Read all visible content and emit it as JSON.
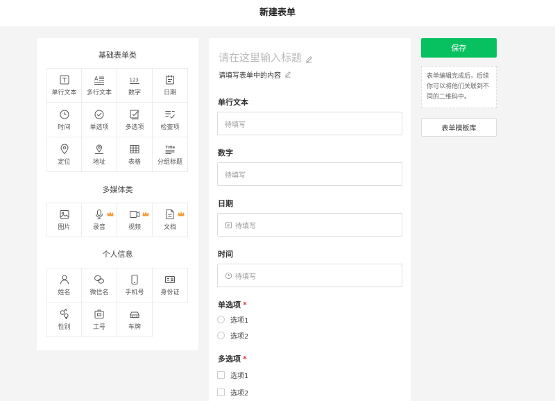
{
  "header": {
    "title": "新建表单"
  },
  "palette": {
    "basic_title": "基础表单类",
    "basic_items": [
      {
        "label": "单行文本",
        "icon": "single-line-text-icon"
      },
      {
        "label": "多行文本",
        "icon": "multi-line-text-icon"
      },
      {
        "label": "数字",
        "icon": "number-icon"
      },
      {
        "label": "日期",
        "icon": "calendar-icon"
      },
      {
        "label": "时间",
        "icon": "clock-icon"
      },
      {
        "label": "单选项",
        "icon": "radio-check-icon"
      },
      {
        "label": "多选项",
        "icon": "checkbox-icon"
      },
      {
        "label": "检查项",
        "icon": "checklist-icon"
      },
      {
        "label": "定位",
        "icon": "location-pin-icon"
      },
      {
        "label": "地址",
        "icon": "address-pin-icon"
      },
      {
        "label": "表格",
        "icon": "table-icon"
      },
      {
        "label": "分组标题",
        "icon": "group-title-icon"
      }
    ],
    "media_title": "多媒体类",
    "media_items": [
      {
        "label": "图片",
        "icon": "image-icon",
        "premium": false
      },
      {
        "label": "录音",
        "icon": "microphone-icon",
        "premium": true
      },
      {
        "label": "视频",
        "icon": "video-icon",
        "premium": true
      },
      {
        "label": "文档",
        "icon": "document-icon",
        "premium": true
      }
    ],
    "personal_title": "个人信息",
    "personal_items": [
      {
        "label": "姓名",
        "icon": "person-icon"
      },
      {
        "label": "微信名",
        "icon": "wechat-icon"
      },
      {
        "label": "手机号",
        "icon": "phone-icon"
      },
      {
        "label": "身份证",
        "icon": "id-card-icon"
      },
      {
        "label": "性别",
        "icon": "gender-icon"
      },
      {
        "label": "工号",
        "icon": "badge-icon"
      },
      {
        "label": "车牌",
        "icon": "car-icon"
      }
    ],
    "premium_color": "#f39c38"
  },
  "form": {
    "title_placeholder": "请在这里输入标题",
    "desc_placeholder": "请填写表单中的内容",
    "fields": {
      "single_text": {
        "label": "单行文本",
        "placeholder": "待填写"
      },
      "number": {
        "label": "数字",
        "placeholder": "待填写"
      },
      "date": {
        "label": "日期",
        "placeholder": "待填写"
      },
      "time": {
        "label": "时间",
        "placeholder": "待填写"
      },
      "single_choice": {
        "label": "单选项",
        "required_mark": "*",
        "options": [
          "选项1",
          "选项2"
        ]
      },
      "multi_choice": {
        "label": "多选项",
        "required_mark": "*",
        "options": [
          "选项1",
          "选项2"
        ]
      }
    }
  },
  "sidebar": {
    "save_label": "保存",
    "tip": "表单编辑完成后，后续你可以将他们关联到不同的二维码中。",
    "template_label": "表单模板库"
  },
  "colors": {
    "accent": "#07c160",
    "required": "#e53935"
  }
}
